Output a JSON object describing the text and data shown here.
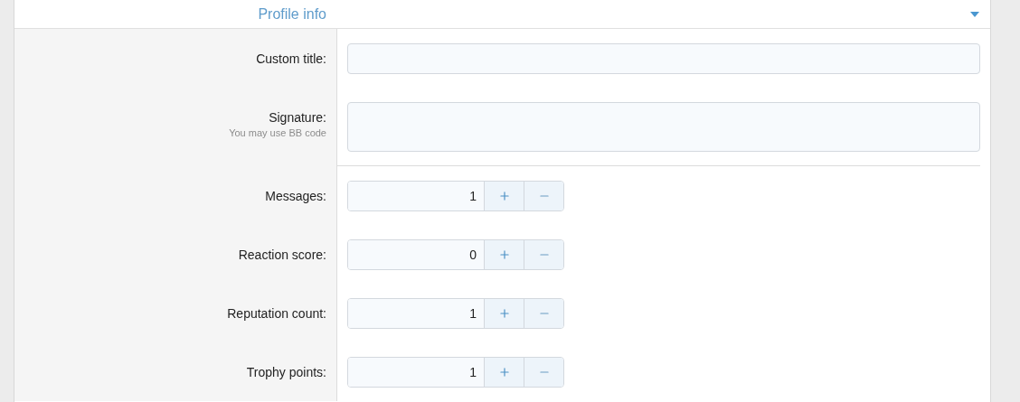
{
  "section": {
    "title": "Profile info",
    "expanded": true
  },
  "text_fields": [
    {
      "label": "Custom title:",
      "kind": "input"
    },
    {
      "label": "Signature:",
      "hint": "You may use BB code",
      "kind": "textarea"
    }
  ],
  "number_fields": [
    {
      "label": "Messages:",
      "value": "1"
    },
    {
      "label": "Reaction score:",
      "value": "0"
    },
    {
      "label": "Reputation count:",
      "value": "1"
    },
    {
      "label": "Trophy points:",
      "value": "1"
    }
  ]
}
